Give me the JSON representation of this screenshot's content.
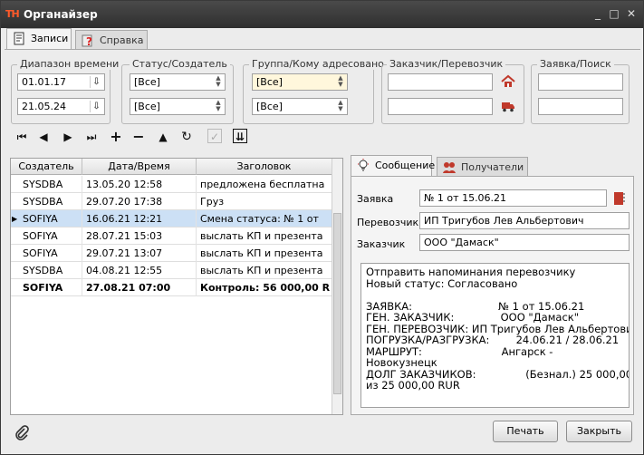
{
  "window": {
    "logo": "TH",
    "title": "Органайзер",
    "minimize": "_",
    "maximize": "□",
    "close": "✕"
  },
  "tabs": [
    {
      "label": "Записи",
      "icon": "notebook-icon",
      "active": true
    },
    {
      "label": "Справка",
      "icon": "help-icon",
      "active": false
    }
  ],
  "filters": {
    "time": {
      "label": "Диапазон времени",
      "from": "01.01.17",
      "to": "21.05.24"
    },
    "status": {
      "label": "Статус/Создатель",
      "status": "[Все]",
      "creator": "[Все]"
    },
    "group": {
      "label": "Группа/Кому адресовано",
      "group": "[Все]",
      "to": "[Все]"
    },
    "customer": {
      "label": "Заказчик/Перевозчик",
      "customer": "",
      "carrier": "",
      "customer_icon": "house-icon",
      "carrier_icon": "truck-icon"
    },
    "order": {
      "label": "Заявка/Поиск",
      "order": "",
      "search": ""
    }
  },
  "toolbar": {
    "first": "⏮",
    "prev": "◀",
    "next": "▶",
    "last": "⏭",
    "add": "+",
    "remove": "−",
    "up": "▲",
    "refresh": "↻",
    "check": "✓",
    "expand": "⇊"
  },
  "grid": {
    "columns": [
      "Создатель",
      "Дата/Время",
      "Заголовок"
    ],
    "rows": [
      {
        "creator": "SYSDBA",
        "date": "13.05.20 12:58",
        "title": "предложена бесплатна"
      },
      {
        "creator": "SYSDBA",
        "date": "29.07.20 17:38",
        "title": "Груз"
      },
      {
        "creator": "SOFIYA",
        "date": "16.06.21 12:21",
        "title": "Смена статуса: № 1 от"
      },
      {
        "creator": "SOFIYA",
        "date": "28.07.21 15:03",
        "title": "выслать КП и презента"
      },
      {
        "creator": "SOFIYA",
        "date": "29.07.21 13:07",
        "title": "выслать КП и презента"
      },
      {
        "creator": "SYSDBA",
        "date": "04.08.21 12:55",
        "title": "выслать КП и презента"
      },
      {
        "creator": "SOFIYA",
        "date": "27.08.21 07:00",
        "title": "Контроль: 56 000,00 R"
      }
    ],
    "selected_row": 2,
    "bold_row": 6,
    "row_marker": "▶"
  },
  "right_tabs": [
    {
      "label": "Сообщение",
      "icon": "lightbulb-icon"
    },
    {
      "label": "Получатели",
      "icon": "users-icon"
    }
  ],
  "detail": {
    "order_label": "Заявка",
    "order_value": "№ 1 от 15.06.21",
    "carrier_label": "Перевозчик",
    "carrier_value": "ИП Тригубов Лев Альбертович",
    "customer_label": "Заказчик",
    "customer_value": "ООО \"Дамаск\"",
    "message": "Отправить напоминания перевозчику\nНовый статус: Согласовано\n\nЗАЯВКА:                          № 1 от 15.06.21\nГЕН. ЗАКАЗЧИК:              ООО \"Дамаск\"\nГЕН. ПЕРЕВОЗЧИК: ИП Тригубов Лев Альбертович\nПОГРУЗКА/РАЗГРУЗКА:        24.06.21 / 28.06.21\nМАРШРУТ:                        Ангарск -\nНовокузнецк\nДОЛГ ЗАКАЗЧИКОВ:               (Безнал.) 25 000,00\nиз 25 000,00 RUR"
  },
  "footer": {
    "attach_icon": "paperclip-icon",
    "print": "Печать",
    "close": "Закрыть"
  }
}
